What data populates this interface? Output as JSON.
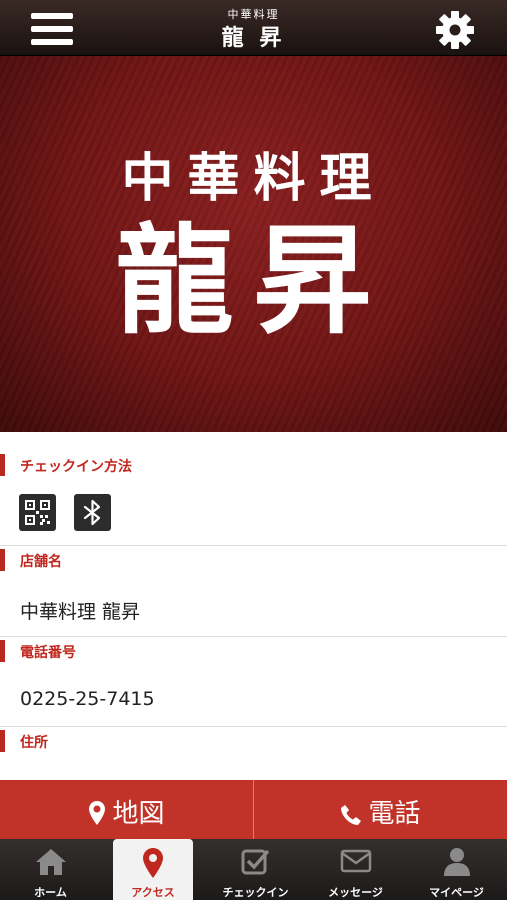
{
  "header": {
    "title_small": "中華料理",
    "title_big": "龍 昇",
    "menu_icon": "hamburger-menu-icon",
    "settings_icon": "gear-icon"
  },
  "hero": {
    "subtitle": "中華料理",
    "name": "龍昇"
  },
  "sections": {
    "checkin": {
      "label": "チェックイン方法",
      "icons": [
        "qr-code-icon",
        "bluetooth-icon"
      ]
    },
    "store": {
      "label": "店舗名",
      "value": "中華料理 龍昇"
    },
    "phone": {
      "label": "電話番号",
      "value": "0225-25-7415"
    },
    "address": {
      "label": "住所"
    }
  },
  "actions": {
    "map_label": "地図",
    "tel_label": "電話"
  },
  "tabs": [
    {
      "label": "ホーム",
      "icon": "home-icon"
    },
    {
      "label": "アクセス",
      "icon": "map-pin-icon",
      "active": true
    },
    {
      "label": "チェックイン",
      "icon": "checkbox-icon"
    },
    {
      "label": "メッセージ",
      "icon": "envelope-icon"
    },
    {
      "label": "マイページ",
      "icon": "user-icon"
    }
  ],
  "colors": {
    "accent_red": "#c13229",
    "label_red": "#c0281f",
    "hero_red": "#6e1414"
  }
}
